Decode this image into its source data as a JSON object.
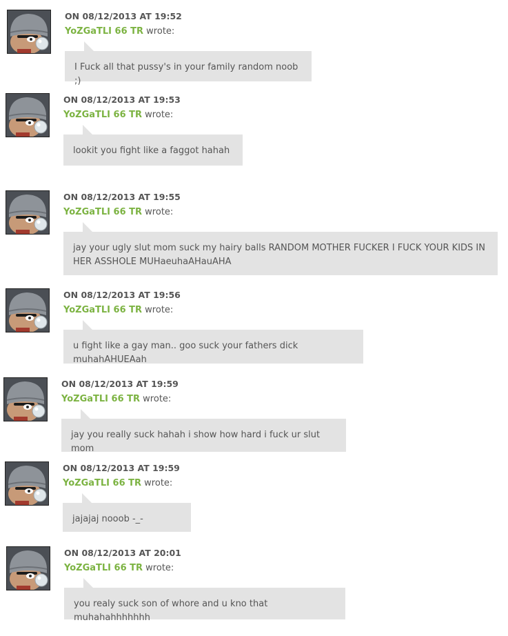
{
  "wrote_label": "wrote:",
  "author_color": "#7cb342",
  "bubble_color": "#e3e3e3",
  "comments": [
    {
      "timestamp": "ON 08/12/2013 AT 19:52",
      "author": "YoZGaTLI 66 TR",
      "text": "I Fuck all that pussy's in your family random noob ;)",
      "avatar_icon": "beanie-cartoon-avatar-icon"
    },
    {
      "timestamp": "ON 08/12/2013 AT 19:53",
      "author": "YoZGaTLI 66 TR",
      "text": "lookit you fight like a faggot hahah",
      "avatar_icon": "beanie-cartoon-avatar-icon"
    },
    {
      "timestamp": "ON 08/12/2013 AT 19:55",
      "author": "YoZGaTLI 66 TR",
      "text": "jay your ugly slut mom suck my hairy balls RANDOM MOTHER FUCKER I FUCK YOUR KIDS IN HER ASSHOLE MUHaeuhaAHauAHA",
      "avatar_icon": "beanie-cartoon-avatar-icon"
    },
    {
      "timestamp": "ON 08/12/2013 AT 19:56",
      "author": "YoZGaTLI 66 TR",
      "text": "u fight like a gay man.. goo suck your fathers dick muhahAHUEAah",
      "avatar_icon": "beanie-cartoon-avatar-icon"
    },
    {
      "timestamp": "ON 08/12/2013 AT 19:59",
      "author": "YoZGaTLI 66 TR",
      "text": "jay you really suck hahah i show how hard i fuck ur slut mom",
      "avatar_icon": "beanie-cartoon-avatar-icon"
    },
    {
      "timestamp": "ON 08/12/2013 AT 19:59",
      "author": "YoZGaTLI 66 TR",
      "text": "jajajaj nooob -_-",
      "avatar_icon": "beanie-cartoon-avatar-icon"
    },
    {
      "timestamp": "ON 08/12/2013 AT 20:01",
      "author": "YoZGaTLI 66 TR",
      "text": "you  realy suck son of whore and u kno that muhahahhhhhhh",
      "avatar_icon": "beanie-cartoon-avatar-icon"
    }
  ]
}
